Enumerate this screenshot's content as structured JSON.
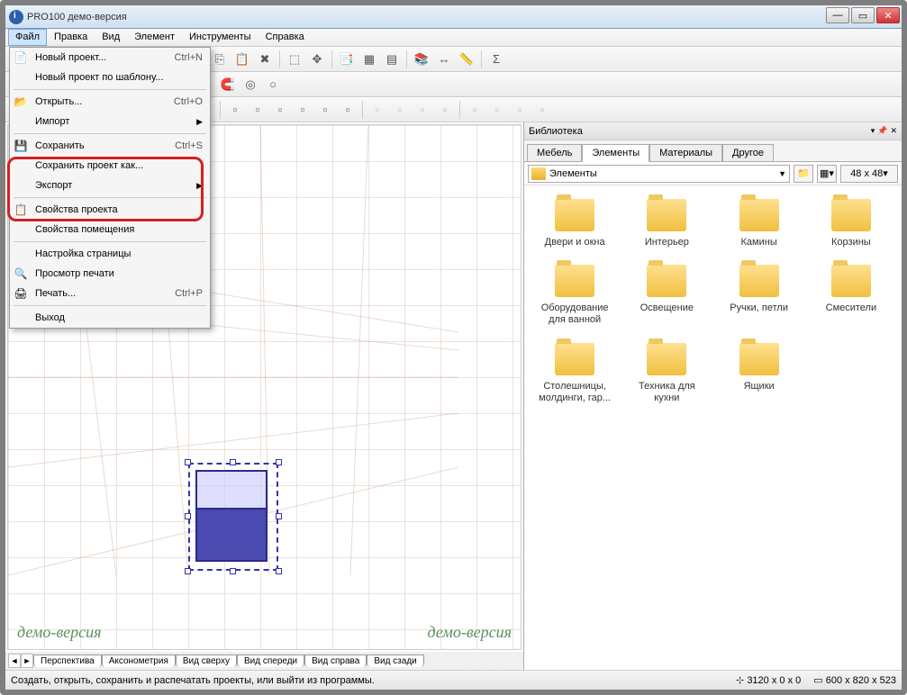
{
  "window": {
    "title": "PRO100 демо-версия"
  },
  "menubar": [
    "Файл",
    "Правка",
    "Вид",
    "Элемент",
    "Инструменты",
    "Справка"
  ],
  "filemenu": {
    "items": [
      {
        "label": "Новый проект...",
        "shortcut": "Ctrl+N",
        "icon": "📄"
      },
      {
        "label": "Новый проект по шаблону..."
      },
      {
        "sep": true
      },
      {
        "label": "Открыть...",
        "shortcut": "Ctrl+O",
        "icon": "📂"
      },
      {
        "label": "Импорт",
        "submenu": true
      },
      {
        "sep": true
      },
      {
        "label": "Сохранить",
        "shortcut": "Ctrl+S",
        "icon": "💾"
      },
      {
        "label": "Сохранить проект как..."
      },
      {
        "label": "Экспорт",
        "submenu": true
      },
      {
        "sep": true
      },
      {
        "label": "Свойства проекта",
        "icon": "📋"
      },
      {
        "label": "Свойства помещения"
      },
      {
        "sep": true
      },
      {
        "label": "Настройка страницы"
      },
      {
        "label": "Просмотр печати",
        "icon": "🔍"
      },
      {
        "label": "Печать...",
        "shortcut": "Ctrl+P",
        "icon": "🖨"
      },
      {
        "sep": true
      },
      {
        "label": "Выход"
      }
    ]
  },
  "watermark": "демо-версия",
  "viewtabs": [
    "Перспектива",
    "Аксонометрия",
    "Вид сверху",
    "Вид спереди",
    "Вид справа",
    "Вид сзади"
  ],
  "library": {
    "title": "Библиотека",
    "tabs": [
      "Мебель",
      "Элементы",
      "Материалы",
      "Другое"
    ],
    "active_tab": 1,
    "path": "Элементы",
    "thumbsize": "48 x  48",
    "folders": [
      "Двери и окна",
      "Интерьер",
      "Камины",
      "Корзины",
      "Оборудование для ванной",
      "Освещение",
      "Ручки, петли",
      "Смесители",
      "Столешницы, молдинги, гар...",
      "Техника для кухни",
      "Ящики"
    ]
  },
  "status": {
    "hint": "Создать, открыть, сохранить и распечатать проекты, или выйти из программы.",
    "coords": "3120 x 0 x 0",
    "size": "600 x 820 x 523"
  }
}
